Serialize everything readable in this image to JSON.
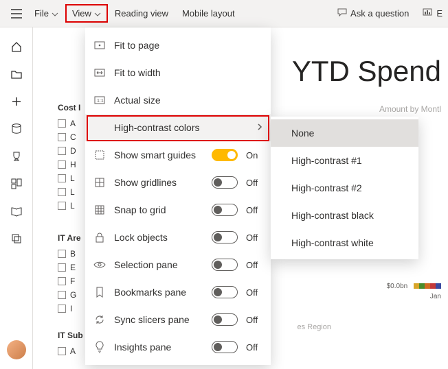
{
  "topbar": {
    "file": "File",
    "view": "View",
    "reading_view": "Reading view",
    "mobile_layout": "Mobile layout",
    "ask_question": "Ask a question",
    "right_partial": "E"
  },
  "leftnav": {
    "items": [
      "home",
      "folder",
      "add",
      "database",
      "trophy",
      "dashboard",
      "book",
      "copy"
    ]
  },
  "report": {
    "title": "YTD Spend",
    "subtitle": "Amount by Montl",
    "small_value": "$0.0bn",
    "small_month": "Jan",
    "region": "es Region"
  },
  "fields": {
    "group1_title": "Cost I",
    "group1_items": [
      "A",
      "C",
      "D",
      "H",
      "L",
      "L",
      "L"
    ],
    "group2_title": "IT Are",
    "group2_items": [
      "B",
      "E",
      "F",
      "G",
      "I"
    ],
    "group3_title": "IT Sub",
    "group3_items": [
      "A"
    ]
  },
  "view_menu": {
    "items": [
      {
        "icon": "fit-page",
        "label": "Fit to page",
        "type": "plain"
      },
      {
        "icon": "fit-width",
        "label": "Fit to width",
        "type": "plain"
      },
      {
        "icon": "actual-size",
        "label": "Actual size",
        "type": "plain"
      },
      {
        "icon": "contrast",
        "label": "High-contrast colors",
        "type": "submenu",
        "hovered": true
      },
      {
        "icon": "smart-guides",
        "label": "Show smart guides",
        "type": "toggle",
        "on": true,
        "state": "On"
      },
      {
        "icon": "gridlines",
        "label": "Show gridlines",
        "type": "toggle",
        "on": false,
        "state": "Off"
      },
      {
        "icon": "snap-grid",
        "label": "Snap to grid",
        "type": "toggle",
        "on": false,
        "state": "Off"
      },
      {
        "icon": "lock",
        "label": "Lock objects",
        "type": "toggle",
        "on": false,
        "state": "Off"
      },
      {
        "icon": "eye",
        "label": "Selection pane",
        "type": "toggle",
        "on": false,
        "state": "Off"
      },
      {
        "icon": "bookmark",
        "label": "Bookmarks pane",
        "type": "toggle",
        "on": false,
        "state": "Off"
      },
      {
        "icon": "sync",
        "label": "Sync slicers pane",
        "type": "toggle",
        "on": false,
        "state": "Off"
      },
      {
        "icon": "bulb",
        "label": "Insights pane",
        "type": "toggle",
        "on": false,
        "state": "Off"
      }
    ]
  },
  "contrast_submenu": {
    "items": [
      "None",
      "High-contrast #1",
      "High-contrast #2",
      "High-contrast black",
      "High-contrast white"
    ],
    "selected": 0
  },
  "swatches": [
    "#d8a52a",
    "#4a8c2b",
    "#d26b1f",
    "#c43a3a",
    "#3a4aa0",
    "#2a6b4a"
  ]
}
